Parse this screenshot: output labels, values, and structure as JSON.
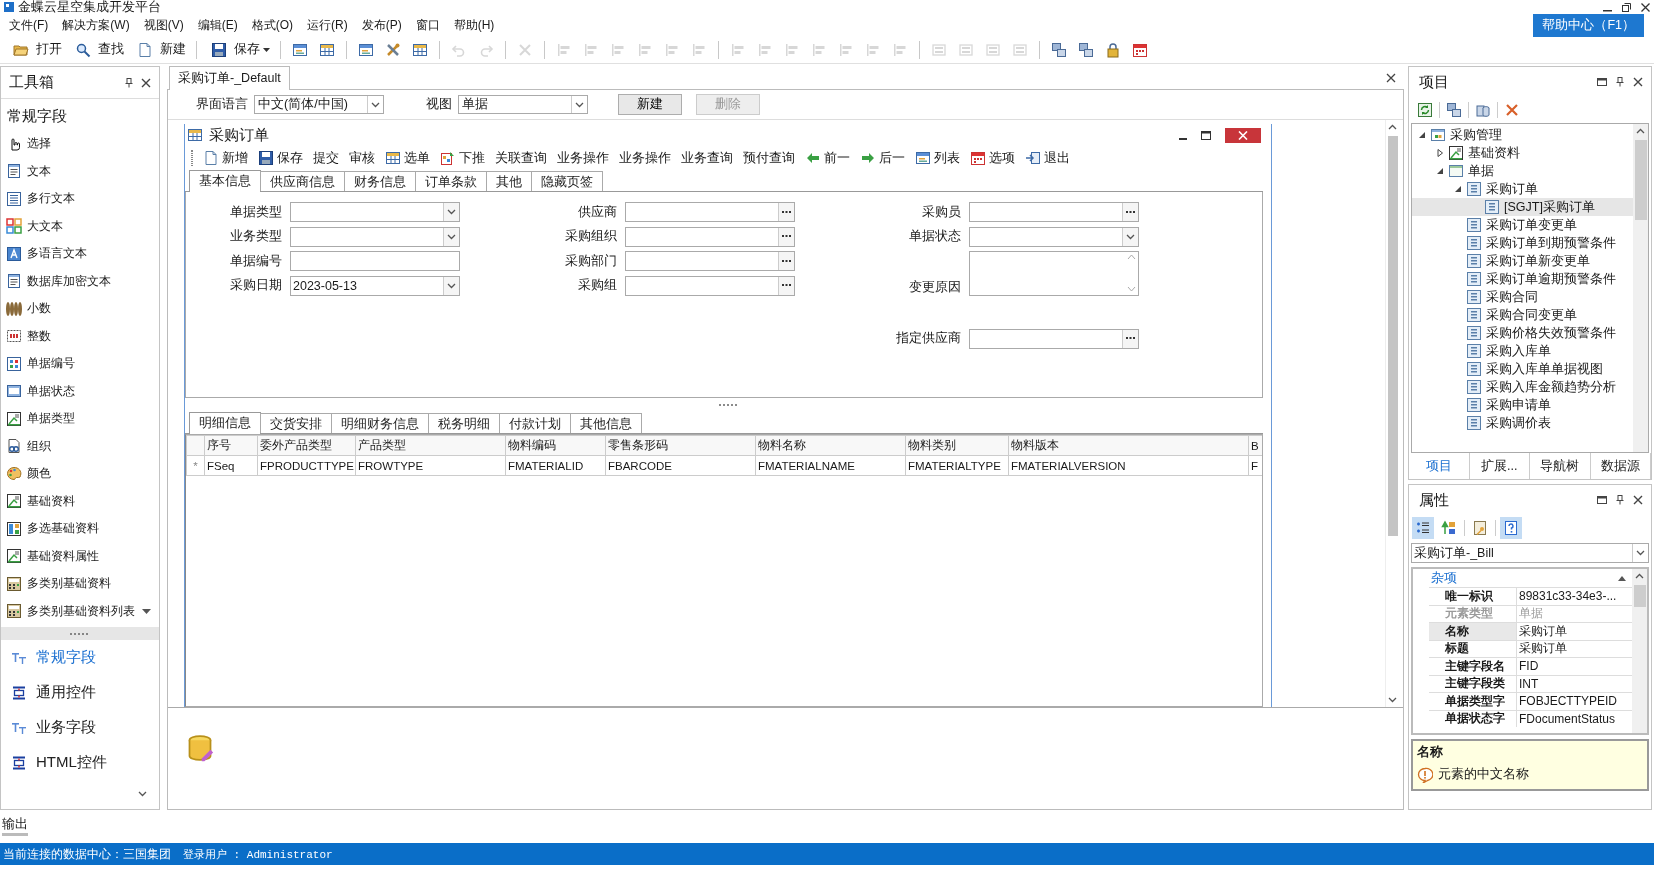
{
  "window": {
    "title": "金蝶云星空集成开发平台"
  },
  "menu": [
    "文件(F)",
    "解决方案(W)",
    "视图(V)",
    "编辑(E)",
    "格式(O)",
    "运行(R)",
    "发布(P)",
    "窗口",
    "帮助(H)"
  ],
  "help_button": "帮助中心（F1）",
  "toolbar": [
    {
      "kind": "button",
      "label": "打开"
    },
    {
      "kind": "button",
      "label": "查找"
    },
    {
      "kind": "button",
      "label": "新建"
    },
    {
      "kind": "separator"
    },
    {
      "kind": "dropdown",
      "label": "保存"
    },
    {
      "kind": "separator"
    },
    {
      "kind": "icon",
      "disabled": false
    },
    {
      "kind": "icon",
      "disabled": false
    },
    {
      "kind": "separator"
    },
    {
      "kind": "icon",
      "disabled": false
    },
    {
      "kind": "icon",
      "disabled": false
    },
    {
      "kind": "icon",
      "disabled": false
    },
    {
      "kind": "separator"
    },
    {
      "kind": "icon",
      "disabled": true
    },
    {
      "kind": "icon",
      "disabled": true
    },
    {
      "kind": "separator"
    },
    {
      "kind": "icon",
      "disabled": true
    },
    {
      "kind": "separator"
    },
    {
      "kind": "icon",
      "disabled": true
    },
    {
      "kind": "icon",
      "disabled": true
    },
    {
      "kind": "icon",
      "disabled": true
    },
    {
      "kind": "icon",
      "disabled": true
    },
    {
      "kind": "icon",
      "disabled": true
    },
    {
      "kind": "icon",
      "disabled": true
    },
    {
      "kind": "separator"
    },
    {
      "kind": "icon",
      "disabled": true
    },
    {
      "kind": "icon",
      "disabled": true
    },
    {
      "kind": "icon",
      "disabled": true
    },
    {
      "kind": "icon",
      "disabled": true
    },
    {
      "kind": "icon",
      "disabled": true
    },
    {
      "kind": "icon",
      "disabled": true
    },
    {
      "kind": "icon",
      "disabled": true
    },
    {
      "kind": "separator"
    },
    {
      "kind": "icon",
      "disabled": true
    },
    {
      "kind": "icon",
      "disabled": true
    },
    {
      "kind": "icon",
      "disabled": true
    },
    {
      "kind": "icon",
      "disabled": true
    },
    {
      "kind": "separator"
    },
    {
      "kind": "icon",
      "disabled": false
    },
    {
      "kind": "icon",
      "disabled": false
    },
    {
      "kind": "icon",
      "disabled": false
    },
    {
      "kind": "icon",
      "disabled": false
    }
  ],
  "toolbox": {
    "title": "工具箱",
    "group": "常规字段",
    "items": [
      "选择",
      "文本",
      "多行文本",
      "大文本",
      "多语言文本",
      "数据库加密文本",
      "小数",
      "整数",
      "单据编号",
      "单据状态",
      "单据类型",
      "组织",
      "颜色",
      "基础资料",
      "多选基础资料",
      "基础资料属性",
      "多类别基础资料",
      "多类别基础资料列表"
    ],
    "sections": [
      {
        "label": "常规字段",
        "selected": true
      },
      {
        "label": "通用控件",
        "selected": false
      },
      {
        "label": "业务字段",
        "selected": false
      },
      {
        "label": "HTML控件",
        "selected": false
      }
    ]
  },
  "document": {
    "tab": "采购订单-_Default",
    "language_label": "界面语言",
    "language_value": "中文(简体/中国)",
    "view_label": "视图",
    "view_value": "单据",
    "buttons": [
      {
        "label": "新建",
        "disabled": false
      },
      {
        "label": "删除",
        "disabled": true
      }
    ],
    "form_window": {
      "title": "采购订单",
      "toolbar": [
        {
          "label": "新增",
          "kind": "icon"
        },
        {
          "label": "保存",
          "kind": "icon"
        },
        {
          "label": "提交",
          "kind": "text"
        },
        {
          "label": "审核",
          "kind": "text"
        },
        {
          "label": "选单",
          "kind": "icon"
        },
        {
          "label": "下推",
          "kind": "icon"
        },
        {
          "label": "关联查询",
          "kind": "text"
        },
        {
          "label": "业务操作",
          "kind": "text"
        },
        {
          "label": "业务操作",
          "kind": "text"
        },
        {
          "label": "业务查询",
          "kind": "text"
        },
        {
          "label": "预付查询",
          "kind": "text"
        },
        {
          "label": "前一",
          "kind": "icon"
        },
        {
          "label": "后一",
          "kind": "icon"
        },
        {
          "label": "列表",
          "kind": "icon"
        },
        {
          "label": "选项",
          "kind": "icon"
        },
        {
          "label": "退出",
          "kind": "icon"
        }
      ],
      "tabs": [
        {
          "label": "基本信息",
          "selected": true
        },
        {
          "label": "供应商信息",
          "selected": false
        },
        {
          "label": "财务信息",
          "selected": false
        },
        {
          "label": "订单条款",
          "selected": false
        },
        {
          "label": "其他",
          "selected": false
        },
        {
          "label": "隐藏页签",
          "selected": false
        }
      ],
      "field_columns": [
        [
          {
            "label": "单据类型",
            "kind": "combo"
          },
          {
            "label": "业务类型",
            "kind": "combo"
          },
          {
            "label": "单据编号",
            "kind": "text"
          },
          {
            "label": "采购日期",
            "kind": "combo",
            "value": "2023-05-13"
          }
        ],
        [
          {
            "label": "供应商",
            "kind": "lookup"
          },
          {
            "label": "采购组织",
            "kind": "lookup"
          },
          {
            "label": "采购部门",
            "kind": "lookup"
          },
          {
            "label": "采购组",
            "kind": "lookup"
          }
        ],
        [
          {
            "label": "采购员",
            "kind": "lookup"
          },
          {
            "label": "单据状态",
            "kind": "combo"
          },
          {
            "label": "变更原因",
            "kind": "memo"
          },
          {
            "label": "指定供应商",
            "kind": "lookup"
          }
        ]
      ],
      "detail_tabs": [
        {
          "label": "明细信息",
          "selected": true
        },
        {
          "label": "交货安排",
          "selected": false
        },
        {
          "label": "明细财务信息",
          "selected": false
        },
        {
          "label": "税务明细",
          "selected": false
        },
        {
          "label": "付款计划",
          "selected": false
        },
        {
          "label": "其他信息",
          "selected": false
        }
      ],
      "grid": {
        "columns": [
          "序号",
          "委外产品类型",
          "产品类型",
          "物料编码",
          "零售条形码",
          "物料名称",
          "物料类别",
          "物料版本",
          "B"
        ],
        "row_marker": "*",
        "rows": [
          [
            "FSeq",
            "FPRODUCTTYPE",
            "FROWTYPE",
            "FMATERIALID",
            "FBARCODE",
            "FMATERIALNAME",
            "FMATERIALTYPE",
            "FMATERIALVERSION",
            "F"
          ]
        ]
      }
    }
  },
  "project": {
    "title": "项目",
    "tree": [
      {
        "label": "采购管理",
        "expanded": true,
        "selected": false,
        "children": [
          {
            "label": "基础资料",
            "expanded": false,
            "selected": false
          },
          {
            "label": "单据",
            "expanded": true,
            "selected": false,
            "children": [
              {
                "label": "采购订单",
                "expanded": true,
                "selected": false,
                "children": [
                  {
                    "label": "[SGJT]采购订单",
                    "selected": true
                  }
                ]
              },
              {
                "label": "采购订单变更单",
                "selected": false
              },
              {
                "label": "采购订单到期预警条件",
                "selected": false
              },
              {
                "label": "采购订单新变更单",
                "selected": false
              },
              {
                "label": "采购订单逾期预警条件",
                "selected": false
              },
              {
                "label": "采购合同",
                "selected": false
              },
              {
                "label": "采购合同变更单",
                "selected": false
              },
              {
                "label": "采购价格失效预警条件",
                "selected": false
              },
              {
                "label": "采购入库单",
                "selected": false
              },
              {
                "label": "采购入库单单据视图",
                "selected": false
              },
              {
                "label": "采购入库金额趋势分析",
                "selected": false
              },
              {
                "label": "采购申请单",
                "selected": false
              },
              {
                "label": "采购调价表",
                "selected": false
              }
            ]
          }
        ]
      }
    ],
    "tabs": [
      {
        "label": "项目",
        "selected": true
      },
      {
        "label": "扩展...",
        "selected": false
      },
      {
        "label": "导航树",
        "selected": false
      },
      {
        "label": "数据源",
        "selected": false
      }
    ]
  },
  "properties": {
    "title": "属性",
    "toolbar": [
      {
        "pressed": true
      },
      {
        "pressed": false
      },
      {
        "pressed": false
      },
      {
        "pressed": true
      }
    ],
    "object": "采购订单-_Bill",
    "category": "杂项",
    "rows": [
      {
        "name": "唯一标识",
        "value": "89831c33-34e3-...",
        "disabled": false,
        "selected": false
      },
      {
        "name": "元素类型",
        "value": "单据",
        "disabled": true,
        "selected": false
      },
      {
        "name": "名称",
        "value": "采购订单",
        "disabled": false,
        "selected": true
      },
      {
        "name": "标题",
        "value": "采购订单",
        "disabled": false,
        "selected": false
      },
      {
        "name": "主键字段名",
        "value": "FID",
        "disabled": false,
        "selected": false
      },
      {
        "name": "主键字段类",
        "value": "INT",
        "disabled": false,
        "selected": false
      },
      {
        "name": "单据类型字",
        "value": "FOBJECTTYPEID",
        "disabled": false,
        "selected": false
      },
      {
        "name": "单据状态字",
        "value": "FDocumentStatus",
        "disabled": false,
        "selected": false
      }
    ],
    "help_title": "名称",
    "help_text": "元素的中文名称"
  },
  "output_label": "输出",
  "status": {
    "connection": "当前连接的数据中心：三国集团",
    "user": "登录用户 : Administrator"
  }
}
